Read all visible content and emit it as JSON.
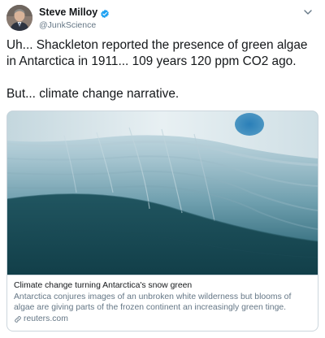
{
  "author": {
    "display_name": "Steve Milloy",
    "handle": "@JunkScience",
    "verified_icon": "verified-badge-icon",
    "avatar_icon": "avatar"
  },
  "menu_icon": "chevron-down-icon",
  "tweet": {
    "line1": "Uh... Shackleton reported the presence of green algae",
    "line2": "in Antarctica in 1911... 109 years 120 ppm CO2 ago.",
    "line3": "But... climate change narrative."
  },
  "card": {
    "title": "Climate change turning Antarctica's snow green",
    "description": "Antarctica conjures images of an unbroken white wilderness but blooms of algae are giving parts of the frozen continent an increasingly green tinge.",
    "domain": "reuters.com",
    "link_icon": "link-icon"
  },
  "colors": {
    "text": "#14171a",
    "secondary": "#657786",
    "border": "#ccd6dd",
    "verified": "#1da1f2"
  }
}
